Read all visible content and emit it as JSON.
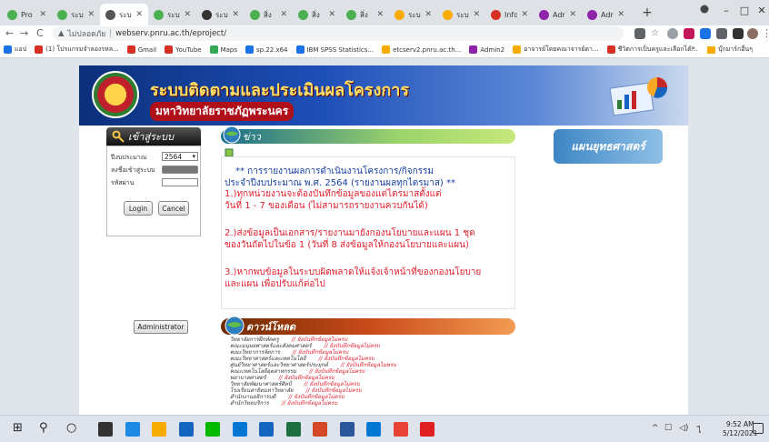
{
  "browser": {
    "tabs": [
      {
        "title": "Pro",
        "icon": "globe-icon",
        "color": "#4caf50"
      },
      {
        "title": "ระบบ",
        "icon": "globe-icon",
        "color": "#4caf50"
      },
      {
        "title": "ระบ",
        "icon": "globe-icon",
        "color": "#555555"
      },
      {
        "title": "ระบ",
        "icon": "globe-icon",
        "color": "#4caf50"
      },
      {
        "title": "ระบ",
        "icon": "home-icon",
        "color": "#333333"
      },
      {
        "title": "สิ่ง",
        "icon": "globe-icon",
        "color": "#4caf50"
      },
      {
        "title": "สิ่ง",
        "icon": "globe-icon",
        "color": "#4caf50"
      },
      {
        "title": "สิ่ง",
        "icon": "globe-icon",
        "color": "#4caf50"
      },
      {
        "title": "ระบ",
        "icon": "drive-icon",
        "color": "#f9ab00"
      },
      {
        "title": "ระบ",
        "icon": "drive-icon",
        "color": "#f9ab00"
      },
      {
        "title": "Info",
        "icon": "red-circle-icon",
        "color": "#d93025"
      },
      {
        "title": "Adr",
        "icon": "admin-icon",
        "color": "#8e24aa"
      },
      {
        "title": "Adr",
        "icon": "admin-icon",
        "color": "#8e24aa"
      }
    ],
    "active_tab_index": 2,
    "new_tab_label": "+",
    "window_controls": {
      "minimize": "–",
      "maximize": "□",
      "close": "✕"
    },
    "address": {
      "security_label": "ไม่ปลอดภัย",
      "url": "webserv.pnru.ac.th/eproject/"
    },
    "bookmarks": [
      {
        "label": "แอป",
        "color": "#1a73e8"
      },
      {
        "label": "(1) โปรแกรมจำลองรหล...",
        "color": "#d93025"
      },
      {
        "label": "Gmail",
        "color": "#d93025"
      },
      {
        "label": "YouTube",
        "color": "#d93025"
      },
      {
        "label": "Maps",
        "color": "#34a853"
      },
      {
        "label": "sp.22.x64",
        "color": "#1a73e8"
      },
      {
        "label": "IBM SPSS Statistics...",
        "color": "#1a73e8"
      },
      {
        "label": "etcserv2.pnru.ac.th...",
        "color": "#f9ab00"
      },
      {
        "label": "Admin2",
        "color": "#8e24aa"
      },
      {
        "label": "อาจารย์โดยคณาจารย์ดา...",
        "color": "#f9ab00"
      },
      {
        "label": "ชีวิตการเป็นครูและเลือกได้...",
        "color": "#d93025"
      }
    ],
    "bookmarks_more": "»",
    "bookmarks_other": "บุ๊กมาร์กอื่นๆ"
  },
  "site": {
    "title_main": "ระบบติดตามและประเมินผลโครงการ",
    "title_sub": "มหาวิทยาลัยราชภัฏพระนคร",
    "login": {
      "heading": "เข้าสู่ระบบ",
      "year_label": "ปีงบประมาณ",
      "year_value": "2564",
      "username_label": "ลงชื่อเข้าสู่ระบบ",
      "password_label": "รหัสผ่าน",
      "login_button": "Login",
      "cancel_button": "Cancel"
    },
    "admin_button": "Administrator",
    "news": {
      "heading": "ข่าว",
      "title_line1": "** การรายงานผลการดำเนินงานโครงการ/กิจกรรม",
      "title_line2": "ประจำปีงบประมาณ พ.ศ. 2564 (รายงานผลทุกไตรมาส) **",
      "item1_line1": "1.)ทุกหน่วยงานจะต้องบันทึกข้อมูลของแต่ไตรมาสตั้งแต่",
      "item1_line2": "วันที่ 1 - 7 ของเดือน (ไม่สามารถรายงานควบกันได้)",
      "item2_line1": "2.)ส่งข้อมูลเป็นเอกสาร/รายงานมายังกองนโยบายและแผน 1 ชุด",
      "item2_line2": "ของวันถัดไปในข้อ 1 (วันที่ 8 ส่งข้อมูลให้กองนโยบายและแผน)",
      "item3_line1": "3.)หากพบข้อมูลในระบบผิดพลาดให้แจ้งเจ้าหน้าที่ของกองนโยบาย",
      "item3_line2": "และแผน เพื่อปรับแก้ต่อไป"
    },
    "faculty_panel": "แผนยุทธศาสตร์",
    "download": {
      "heading": "ดาวน์โหลด",
      "items": [
        {
          "name": "วิทยาลัยการฝึกหัดครู",
          "status": "// ยังบันทึกข้อมูลไม่ครบ"
        },
        {
          "name": "คณะมนุษยศาสตร์และสังคมศาสตร์",
          "status": "// ยังบันทึกข้อมูลไม่ครบ"
        },
        {
          "name": "คณะวิทยาการจัดการ",
          "status": "// ยังบันทึกข้อมูลไม่ครบ"
        },
        {
          "name": "คณะวิทยาศาสตร์และเทคโนโลยี",
          "status": "// ยังบันทึกข้อมูลไม่ครบ"
        },
        {
          "name": "ศูนย์วิทยาศาสตร์และวิทยาศาสตร์ประยุกต์",
          "status": "// ยังบันทึกข้อมูลไม่ครบ"
        },
        {
          "name": "คณะเทคโนโลยีอุตสาหกรรม",
          "status": "// ยังบันทึกข้อมูลไม่ครบ"
        },
        {
          "name": "พยาบาลศาสตร์",
          "status": "// ยังบันทึกข้อมูลไม่ครบ"
        },
        {
          "name": "วิทยาลัยพัฒนาศาสตร์ศิลป์",
          "status": "// ยังบันทึกข้อมูลไม่ครบ"
        },
        {
          "name": "โรงเรียนสาธิตมหาวิทยาลัย",
          "status": "// ยังบันทึกข้อมูลไม่ครบ"
        },
        {
          "name": "สำนักงานอธิการบดี",
          "status": "// ยังบันทึกข้อมูลไม่ครบ"
        },
        {
          "name": "สำนักวิทยบริการ",
          "status": "// ยังบันทึกข้อมูลไม่ครบ"
        }
      ]
    }
  },
  "taskbar": {
    "apps": [
      {
        "icon": "task-view-icon",
        "color": "#333333"
      },
      {
        "icon": "edge-icon",
        "color": "#1e88e5"
      },
      {
        "icon": "file-explorer-icon",
        "color": "#f9ab00"
      },
      {
        "icon": "store-icon",
        "color": "#1565c0"
      },
      {
        "icon": "line-icon",
        "color": "#00b900"
      },
      {
        "icon": "mail-icon",
        "color": "#0078d4"
      },
      {
        "icon": "monitor-icon",
        "color": "#1565c0"
      },
      {
        "icon": "excel-icon",
        "color": "#1d6f42"
      },
      {
        "icon": "powerpoint-icon",
        "color": "#d24726"
      },
      {
        "icon": "word-icon",
        "color": "#2b579a"
      },
      {
        "icon": "settings-icon",
        "color": "#0078d4"
      },
      {
        "icon": "chrome-icon",
        "color": "#ea4335"
      },
      {
        "icon": "acrobat-icon",
        "color": "#e02020"
      }
    ],
    "time": "9:52 AM",
    "date": "5/12/2021"
  }
}
